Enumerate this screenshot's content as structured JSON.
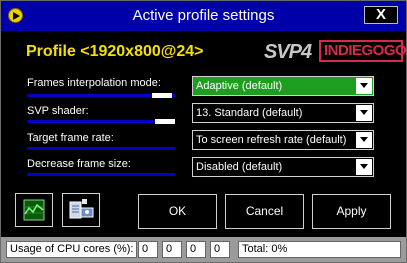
{
  "window": {
    "title": "Active profile settings",
    "close_label": "X"
  },
  "profile": {
    "title": "Profile <1920x800@24>"
  },
  "logo": {
    "svp": "SVP4",
    "indiegogo": "INDIEGOGO"
  },
  "settings": [
    {
      "label": "Frames interpolation mode:",
      "value": "Adaptive (default)",
      "level": 0.85
    },
    {
      "label": "SVP shader:",
      "value": "13. Standard (default)",
      "level": 0.9
    },
    {
      "label": "Target frame rate:",
      "value": "To screen refresh rate (default)",
      "level": 0.0
    },
    {
      "label": "Decrease frame size:",
      "value": "Disabled (default)",
      "level": 0.0
    }
  ],
  "buttons": {
    "ok": "OK",
    "cancel": "Cancel",
    "apply": "Apply"
  },
  "icons": {
    "graph": "graph-icon",
    "settings": "settings-icon"
  },
  "status": {
    "cpu_label": "Usage of CPU cores (%):",
    "cores": [
      "0",
      "0",
      "0",
      "0"
    ],
    "total": "Total: 0%"
  }
}
